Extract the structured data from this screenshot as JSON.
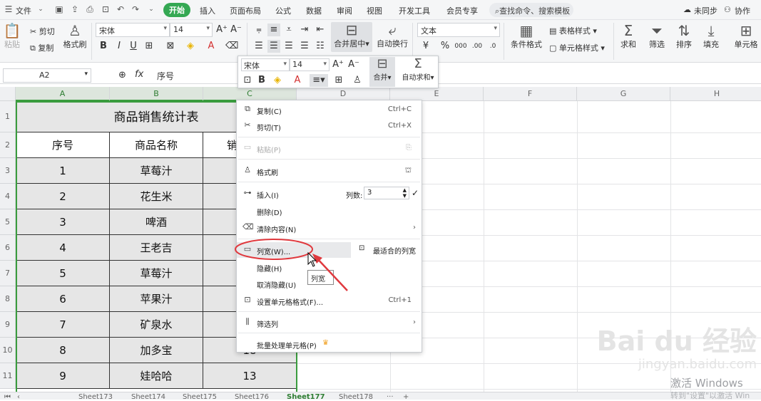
{
  "menubar": {
    "file_label": "文件",
    "tabs": [
      "开始",
      "插入",
      "页面布局",
      "公式",
      "数据",
      "审阅",
      "视图",
      "开发工具",
      "会员专享"
    ],
    "search_placeholder": "查找命令、搜索模板",
    "sync_label": "未同步",
    "collab_label": "协作"
  },
  "ribbon": {
    "paste": "粘贴",
    "cut": "剪切",
    "copy": "复制",
    "format_painter": "格式刷",
    "font_name": "宋体",
    "font_size": "14",
    "merge_center": "合并居中",
    "auto_wrap": "自动换行",
    "number_format": "文本",
    "currency": "¥",
    "percent": "%",
    "conditional_format": "条件格式",
    "table_style": "表格样式",
    "cell_style": "单元格样式",
    "sum": "求和",
    "filter": "筛选",
    "sort": "排序",
    "fill": "填充",
    "cells": "单元格"
  },
  "formula_bar": {
    "name_box": "A2",
    "fx": "fx",
    "content": "序号"
  },
  "columns": [
    "A",
    "B",
    "C",
    "D",
    "E",
    "F",
    "G",
    "H"
  ],
  "rows": [
    "1",
    "2",
    "3",
    "4",
    "5",
    "6",
    "7",
    "8",
    "9",
    "10",
    "11"
  ],
  "table": {
    "title": "商品销售统计表",
    "headers": [
      "序号",
      "商品名称",
      "销"
    ],
    "body": [
      [
        "1",
        "草莓汁",
        ""
      ],
      [
        "2",
        "花生米",
        ""
      ],
      [
        "3",
        "啤酒",
        ""
      ],
      [
        "4",
        "王老吉",
        ""
      ],
      [
        "5",
        "草莓汁",
        ""
      ],
      [
        "6",
        "苹果汁",
        ""
      ],
      [
        "7",
        "矿泉水",
        ""
      ],
      [
        "8",
        "加多宝",
        "18"
      ],
      [
        "9",
        "娃哈哈",
        "13"
      ]
    ]
  },
  "mini_toolbar": {
    "font_name": "宋体",
    "font_size": "14",
    "merge": "合并",
    "autosum": "自动求和"
  },
  "context_menu": {
    "copy": "复制(C)",
    "copy_shortcut": "Ctrl+C",
    "cut": "剪切(T)",
    "cut_shortcut": "Ctrl+X",
    "paste": "粘贴(P)",
    "format_painter": "格式刷",
    "insert": "插入(I)",
    "columns_label": "列数:",
    "columns_value": "3",
    "delete": "删除(D)",
    "clear": "清除内容(N)",
    "column_width": "列宽(W)...",
    "best_fit": "最适合的列宽",
    "hide": "隐藏(H)",
    "unhide": "取消隐藏(U)",
    "format_cells": "设置单元格格式(F)...",
    "format_cells_shortcut": "Ctrl+1",
    "filter_col": "筛选列",
    "batch": "批量处理单元格(P)"
  },
  "tooltip": "列宽",
  "sheets": [
    "Sheet173",
    "Sheet174",
    "Sheet175",
    "Sheet176",
    "Sheet177",
    "Sheet178"
  ],
  "active_sheet": "Sheet177",
  "watermark": {
    "brand": "Bai du 经验",
    "url": "jingyan.baidu.com"
  },
  "windows_activation": {
    "line1": "激活 Windows",
    "line2": "转到\"设置\"以激活 Win"
  },
  "colors": {
    "accent": "#34a853",
    "highlight_ellipse": "#e0393e",
    "selection_border": "#3a9c3e"
  }
}
